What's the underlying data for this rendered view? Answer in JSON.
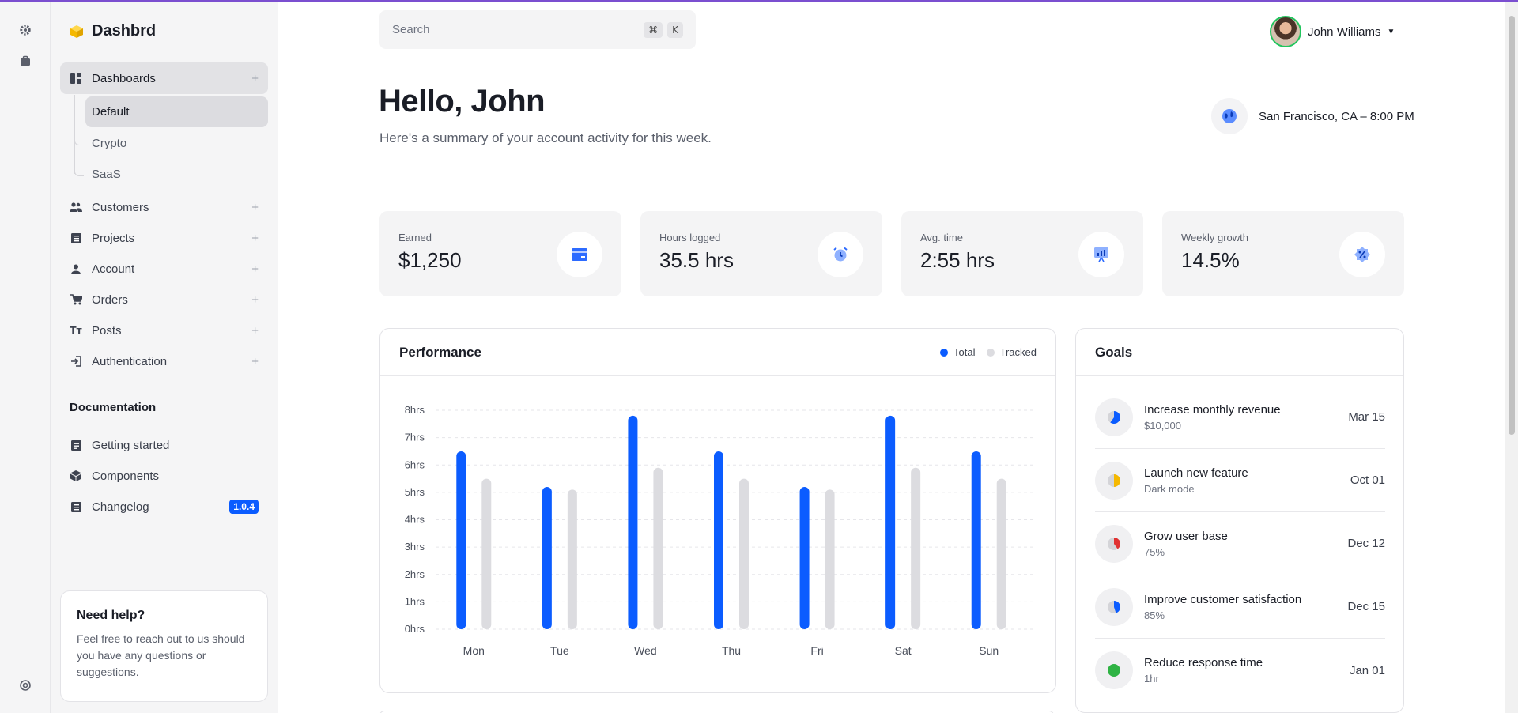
{
  "brand": {
    "name": "Dashbrd"
  },
  "search": {
    "placeholder": "Search",
    "kbd1": "⌘",
    "kbd2": "K"
  },
  "user": {
    "name": "John Williams"
  },
  "sidebar": {
    "items": [
      {
        "label": "Dashboards",
        "icon": "dashboard-icon",
        "expanded": true
      },
      {
        "label": "Customers",
        "icon": "users-icon"
      },
      {
        "label": "Projects",
        "icon": "list-icon"
      },
      {
        "label": "Account",
        "icon": "person-icon"
      },
      {
        "label": "Orders",
        "icon": "cart-icon"
      },
      {
        "label": "Posts",
        "icon": "text-icon"
      },
      {
        "label": "Authentication",
        "icon": "login-icon"
      }
    ],
    "sub_items": [
      "Default",
      "Crypto",
      "SaaS"
    ],
    "docs_label": "Documentation",
    "docs": [
      {
        "label": "Getting started",
        "icon": "doc-icon"
      },
      {
        "label": "Components",
        "icon": "cube-icon"
      },
      {
        "label": "Changelog",
        "icon": "list-icon",
        "badge": "1.0.4"
      }
    ],
    "help": {
      "title": "Need help?",
      "text": "Feel free to reach out to us should you have any questions or suggestions."
    }
  },
  "header": {
    "greeting": "Hello, John",
    "subtitle": "Here's a summary of your account activity for this week.",
    "location": "San Francisco, CA – 8:00 PM"
  },
  "stats": [
    {
      "label": "Earned",
      "value": "$1,250",
      "icon": "card-icon"
    },
    {
      "label": "Hours logged",
      "value": "35.5 hrs",
      "icon": "alarm-icon"
    },
    {
      "label": "Avg. time",
      "value": "2:55 hrs",
      "icon": "presentation-icon"
    },
    {
      "label": "Weekly growth",
      "value": "14.5%",
      "icon": "percent-badge-icon"
    }
  ],
  "performance": {
    "title": "Performance",
    "legend_total": "Total",
    "legend_tracked": "Tracked"
  },
  "chart_data": {
    "type": "bar",
    "categories": [
      "Mon",
      "Tue",
      "Wed",
      "Thu",
      "Fri",
      "Sat",
      "Sun"
    ],
    "series": [
      {
        "name": "Total",
        "values": [
          6.5,
          5.2,
          7.8,
          6.5,
          5.2,
          7.8,
          6.5
        ],
        "color": "#0b5cff"
      },
      {
        "name": "Tracked",
        "values": [
          5.5,
          5.1,
          5.9,
          5.5,
          5.1,
          5.9,
          5.5
        ],
        "color": "#dcdce0"
      }
    ],
    "ytick_labels": [
      "0hrs",
      "1hrs",
      "2hrs",
      "3hrs",
      "4hrs",
      "5hrs",
      "6hrs",
      "7hrs",
      "8hrs"
    ],
    "ylim": [
      0,
      8
    ],
    "grid": true
  },
  "goals": {
    "title": "Goals",
    "items": [
      {
        "title": "Increase monthly revenue",
        "sub": "$10,000",
        "date": "Mar 15",
        "color": "#0b5cff",
        "progress": 0.6
      },
      {
        "title": "Launch new feature",
        "sub": "Dark mode",
        "date": "Oct 01",
        "color": "#f5b800",
        "progress": 0.5
      },
      {
        "title": "Grow user base",
        "sub": "75%",
        "date": "Dec 12",
        "color": "#e03131",
        "progress": 0.4
      },
      {
        "title": "Improve customer satisfaction",
        "sub": "85%",
        "date": "Dec 15",
        "color": "#0b5cff",
        "progress": 0.45
      },
      {
        "title": "Reduce response time",
        "sub": "1hr",
        "date": "Jan 01",
        "color": "#2fb344",
        "progress": 1
      }
    ]
  },
  "colors": {
    "accent": "#0b5cff",
    "topline": "#7b4fd0"
  }
}
